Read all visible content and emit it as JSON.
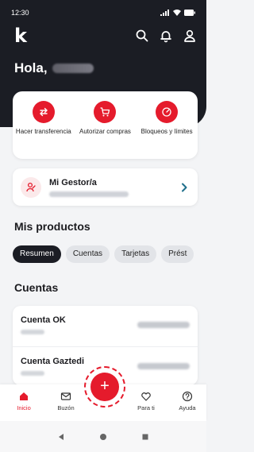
{
  "status_bar": {
    "time": "12:30"
  },
  "header": {
    "logo": "k",
    "greeting": "Hola,"
  },
  "quick_actions": [
    {
      "label": "Hacer transferencia",
      "icon": "transfer-icon"
    },
    {
      "label": "Autorizar compras",
      "icon": "cart-icon"
    },
    {
      "label": "Bloqueos y límites",
      "icon": "gauge-icon"
    }
  ],
  "gestor": {
    "title": "Mi Gestor/a"
  },
  "products": {
    "title": "Mis productos",
    "chips": [
      "Resumen",
      "Cuentas",
      "Tarjetas",
      "Prést"
    ]
  },
  "accounts": {
    "title": "Cuentas",
    "items": [
      {
        "name": "Cuenta OK"
      },
      {
        "name": "Cuenta Gaztedi"
      }
    ]
  },
  "tabbar": {
    "items": [
      {
        "label": "Inicio",
        "icon": "home-icon"
      },
      {
        "label": "Buzón",
        "icon": "mail-icon"
      },
      {
        "label": "Para ti",
        "icon": "heart-icon"
      },
      {
        "label": "Ayuda",
        "icon": "help-icon"
      }
    ],
    "fab": "+"
  },
  "colors": {
    "accent": "#e51b2c",
    "header_bg": "#1b1d24",
    "page_bg": "#f3f4f6"
  }
}
